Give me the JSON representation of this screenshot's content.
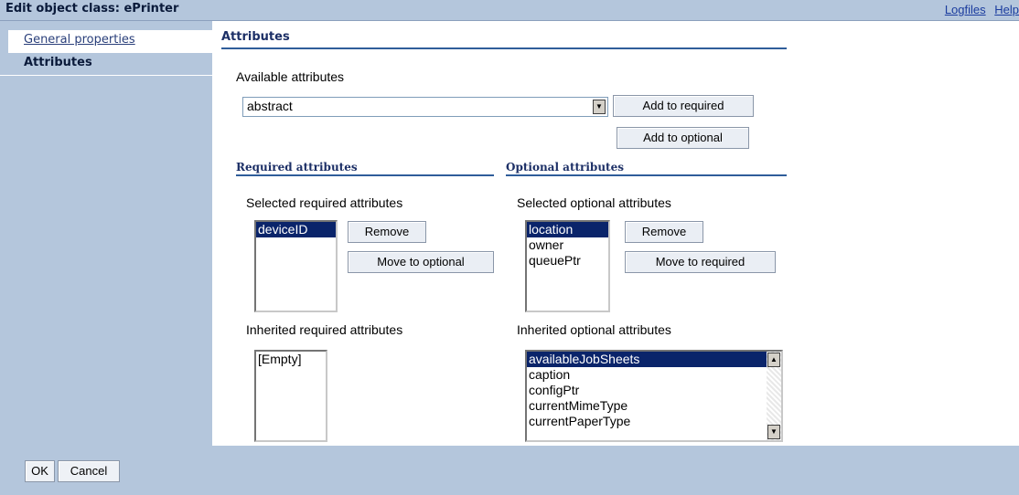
{
  "header": {
    "title": "Edit object class: ePrinter",
    "links": [
      "Logfiles",
      "Help"
    ]
  },
  "sidebar": {
    "items": [
      {
        "label": "General properties"
      },
      {
        "label": "Attributes"
      }
    ]
  },
  "main": {
    "heading": "Attributes",
    "available_label": "Available attributes",
    "available_selected": "abstract",
    "add_required_label": "Add to required",
    "add_optional_label": "Add to optional",
    "required": {
      "heading": "Required attributes",
      "selected_label": "Selected required attributes",
      "selected_items": [
        "deviceID"
      ],
      "remove_label": "Remove",
      "move_label": "Move to optional",
      "inherited_label": "Inherited required attributes",
      "inherited_items": [
        "[Empty]"
      ]
    },
    "optional": {
      "heading": "Optional attributes",
      "selected_label": "Selected optional attributes",
      "selected_items": [
        "location",
        "owner",
        "queuePtr"
      ],
      "remove_label": "Remove",
      "move_label": "Move to required",
      "inherited_label": "Inherited optional attributes",
      "inherited_items": [
        "availableJobSheets",
        "caption",
        "configPtr",
        "currentMimeType",
        "currentPaperType"
      ]
    }
  },
  "footer": {
    "ok_label": "OK",
    "cancel_label": "Cancel"
  }
}
